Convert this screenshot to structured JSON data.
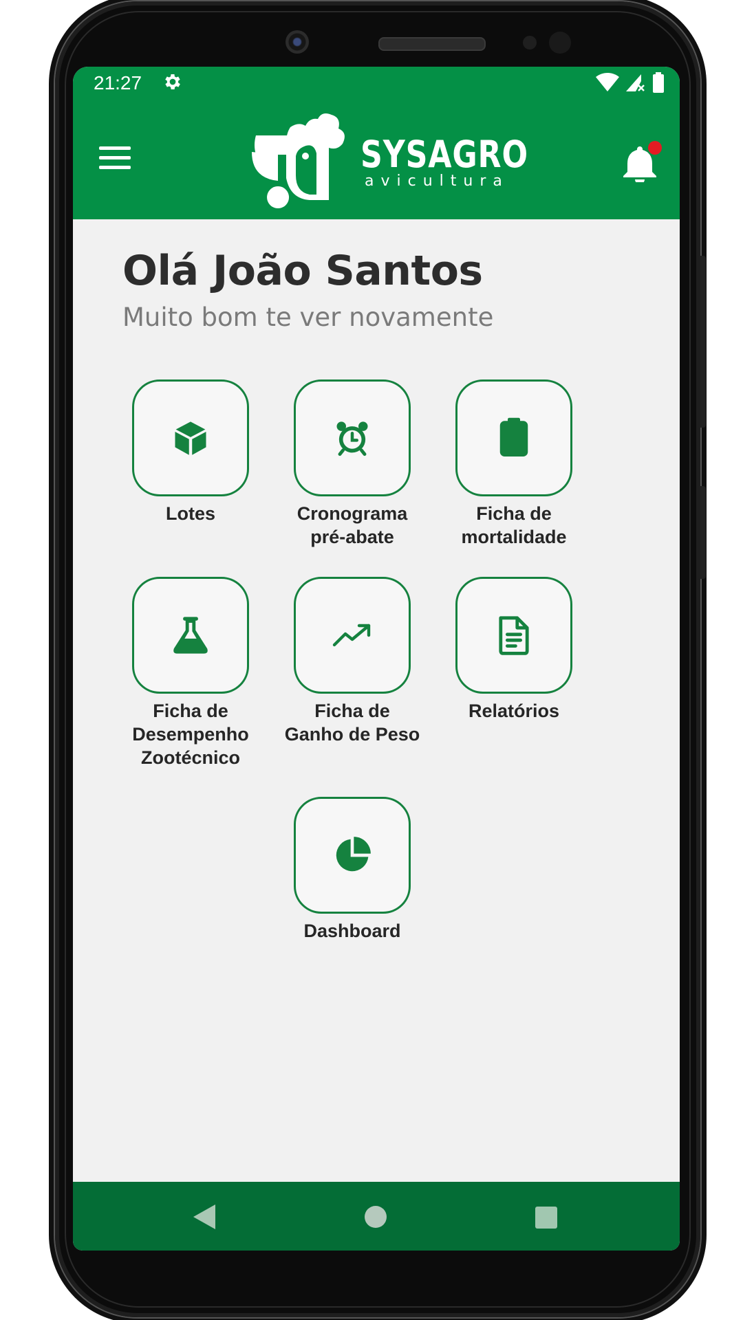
{
  "status_bar": {
    "time": "21:27"
  },
  "app_bar": {
    "logo_title": "SYSAGRO",
    "logo_subtitle": "avicultura"
  },
  "greeting": {
    "title": "Olá João Santos",
    "subtitle": "Muito bom te ver novamente"
  },
  "menu": [
    {
      "label": "Lotes",
      "icon": "cube-icon"
    },
    {
      "label": "Cronograma\npré-abate",
      "icon": "alarm-clock-icon"
    },
    {
      "label": "Ficha de\nmortalidade",
      "icon": "clipboard-icon"
    },
    {
      "label": "Ficha de\nDesempenho\nZootécnico",
      "icon": "flask-icon"
    },
    {
      "label": "Ficha de\nGanho de Peso",
      "icon": "trending-up-icon"
    },
    {
      "label": "Relatórios",
      "icon": "document-icon"
    },
    {
      "label": "Dashboard",
      "icon": "pie-chart-icon"
    }
  ],
  "colors": {
    "brand_green": "#049046",
    "nav_green": "#046d36",
    "tile_border": "#15823f",
    "notification_dot": "#e31b23"
  }
}
